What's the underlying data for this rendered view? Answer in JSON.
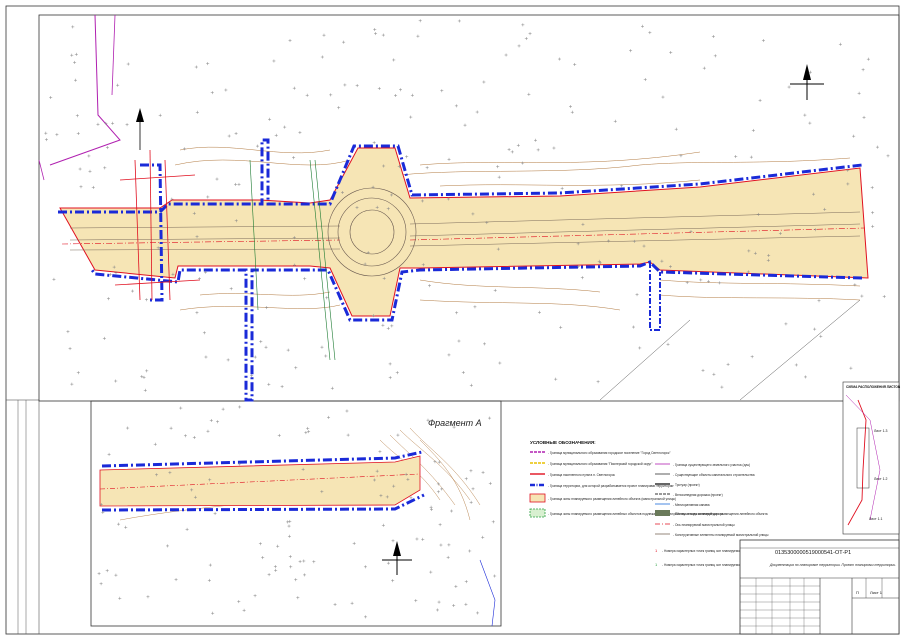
{
  "fragment_label": "Фрагмент А",
  "legend": {
    "title": "УСЛОВНЫЕ ОБОЗНАЧЕНИЯ:",
    "left_items": [
      "- Граница муниципального образования городское поселение \"Город Светлогорск\"",
      "- Граница муниципального образования \"Пионерский городской округ\"",
      "- Граница населенного пункта п. Светлогорск",
      "- Граница территории, для которой разрабатывается проект планировки территории",
      "- Граница зоны планируемого размещения линейного объекта (магистральной улицы)",
      "- Граница зоны планируемого размещения линейных объектов подлежащих переустройству из зоны планируемого размещения линейного объекта"
    ],
    "right_items": [
      "- Граница существующего земельного участка (зуш)",
      "- Существующие объекты капитального строительства",
      "- Тротуар (проект)",
      "- Велосипедная дорожка (проект)",
      "- Мелиоративная канава",
      "- Полоса отвода железной дороги",
      "- Ось планируемой магистральной улицы",
      "- Конструктивные элементы планируемой магистральной улицы"
    ],
    "point_items": [
      "- Номера характерных точек границ зон планируемого размещения линейного объекта",
      "- Номера характерных точек границ зон планируемого размещения линейных объектов подлежащих переустройству"
    ]
  },
  "title_block": {
    "code": "0135300000519000541-ОТ-Р1",
    "description": "Документация по планировке территории. Проект планировки территории.",
    "sheet_label": "Лист 1",
    "stage": "П"
  },
  "key_plan": {
    "title": "СХЕМА РАСПОЛОЖЕНИЯ ЛИСТОВ",
    "sheets": [
      "Лист 1.1",
      "Лист 1.2",
      "Лист 1.3"
    ]
  },
  "north_label": "С",
  "colors": {
    "blue_boundary": "#1a2ad8",
    "red_line": "#e01020",
    "corridor_fill": "#f6e5b5",
    "contour": "#a86a2a",
    "magenta": "#b020b0",
    "green": "#2aa040"
  }
}
